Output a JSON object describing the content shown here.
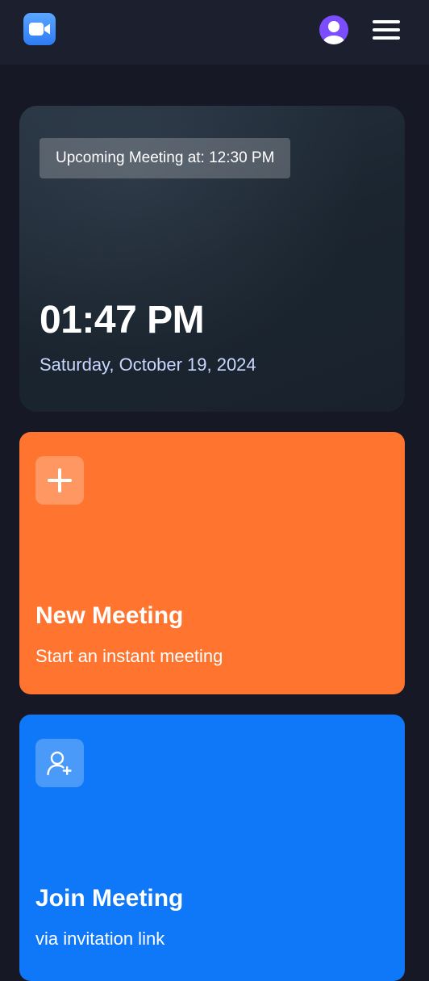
{
  "header": {
    "logo_icon": "video-camera-icon",
    "avatar_icon": "user-avatar-icon",
    "menu_icon": "hamburger-menu-icon"
  },
  "hero": {
    "upcoming_label": "Upcoming Meeting at: 12:30 PM",
    "time": "01:47 PM",
    "date": "Saturday, October 19, 2024"
  },
  "cards": {
    "new_meeting": {
      "icon": "plus-icon",
      "title": "New Meeting",
      "subtitle": "Start an instant meeting",
      "color": "#FF742E"
    },
    "join_meeting": {
      "icon": "add-user-icon",
      "title": "Join Meeting",
      "subtitle": "via invitation link",
      "color": "#0E78F9"
    }
  },
  "colors": {
    "background": "#161925",
    "topbar": "#1C1F2E",
    "avatar": "#7B4DFF",
    "date_text": "#C9D8FF"
  }
}
